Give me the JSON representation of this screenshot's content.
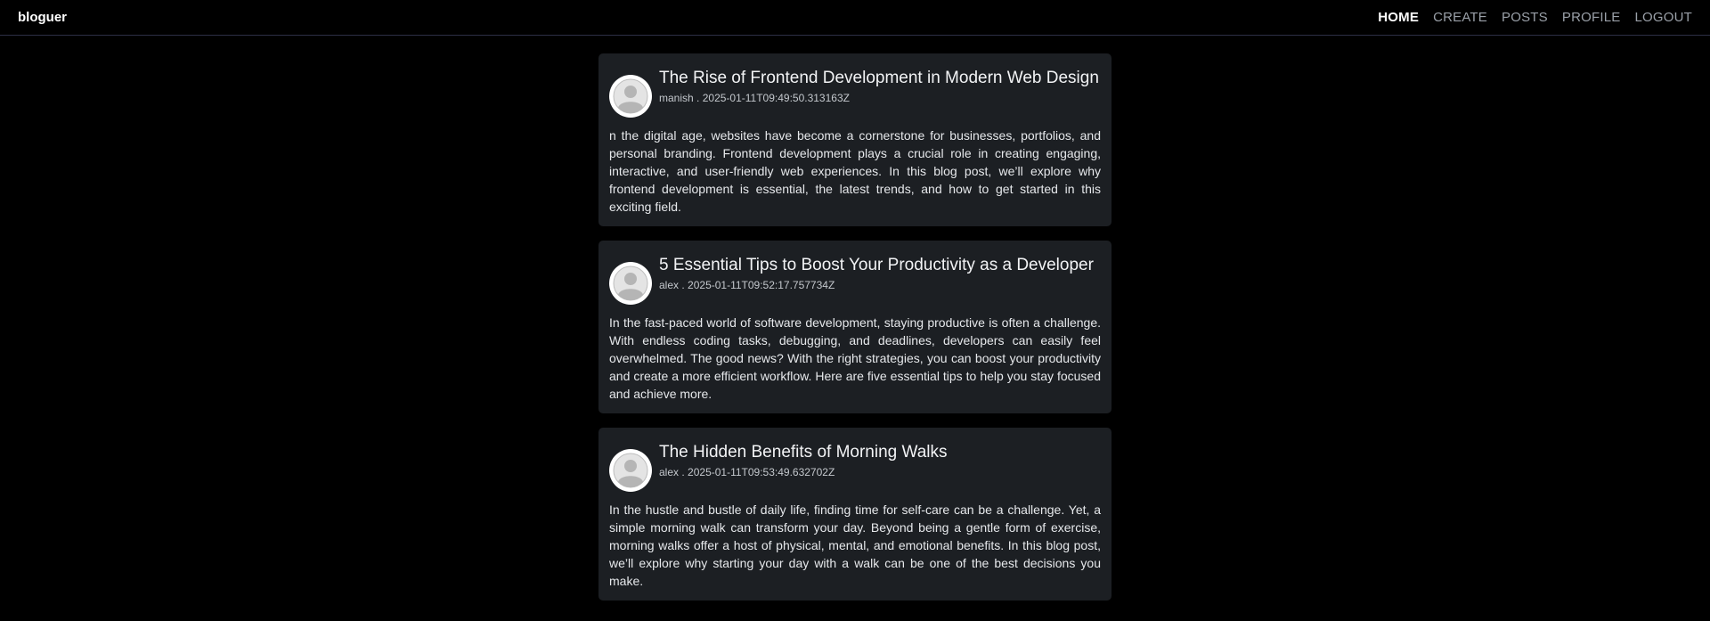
{
  "brand": "bloguer",
  "nav": {
    "home": "HOME",
    "create": "CREATE",
    "posts": "POSTS",
    "profile": "PROFILE",
    "logout": "LOGOUT"
  },
  "posts": [
    {
      "title": "The Rise of Frontend Development in Modern Web Design",
      "author": "manish",
      "separator": ".",
      "date": "2025-01-11T09:49:50.313163Z",
      "body": "n the digital age, websites have become a cornerstone for businesses, portfolios, and personal branding. Frontend development plays a crucial role in creating engaging, interactive, and user-friendly web experiences. In this blog post, we’ll explore why frontend development is essential, the latest trends, and how to get started in this exciting field."
    },
    {
      "title": "5 Essential Tips to Boost Your Productivity as a Developer",
      "author": "alex",
      "separator": ".",
      "date": "2025-01-11T09:52:17.757734Z",
      "body": "In the fast-paced world of software development, staying productive is often a challenge. With endless coding tasks, debugging, and deadlines, developers can easily feel overwhelmed. The good news? With the right strategies, you can boost your productivity and create a more efficient workflow. Here are five essential tips to help you stay focused and achieve more."
    },
    {
      "title": "The Hidden Benefits of Morning Walks",
      "author": "alex",
      "separator": ".",
      "date": "2025-01-11T09:53:49.632702Z",
      "body": "In the hustle and bustle of daily life, finding time for self-care can be a challenge. Yet, a simple morning walk can transform your day. Beyond being a gentle form of exercise, morning walks offer a host of physical, mental, and emotional benefits. In this blog post, we’ll explore why starting your day with a walk can be one of the best decisions you make."
    }
  ],
  "colors": {
    "background": "#000000",
    "card": "#1c1f23",
    "nav_active": "#ffffff",
    "nav_inactive": "#9aa0a8",
    "divider": "#2c2f45"
  },
  "icons": {
    "avatar": "user-avatar-icon"
  }
}
